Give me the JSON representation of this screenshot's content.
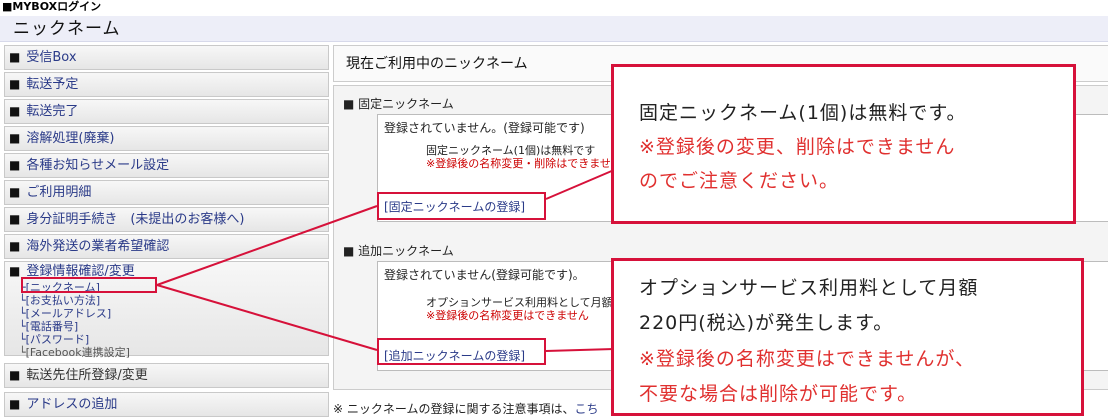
{
  "header": {
    "top_label": "■MYBOXログイン",
    "page_title": "ニックネーム"
  },
  "sidebar": {
    "items": [
      {
        "label": "受信Box"
      },
      {
        "label": "転送予定"
      },
      {
        "label": "転送完了"
      },
      {
        "label": "溶解処理(廃棄)"
      },
      {
        "label": "各種お知らせメール設定"
      },
      {
        "label": "ご利用明細"
      },
      {
        "label": "身分証明手続き　(未提出のお客様へ)"
      },
      {
        "label": "海外発送の業者希望確認"
      },
      {
        "label": "登録情報確認/変更"
      },
      {
        "label": "転送先住所登録/変更"
      },
      {
        "label": "アドレスの追加"
      }
    ],
    "subitems": [
      {
        "label": "ニックネーム"
      },
      {
        "label": "お支払い方法"
      },
      {
        "label": "メールアドレス"
      },
      {
        "label": "電話番号"
      },
      {
        "label": "パスワード"
      },
      {
        "label": "Facebook連携設定"
      }
    ]
  },
  "main": {
    "heading": "現在ご利用中のニックネーム",
    "fixed": {
      "title": "固定ニックネーム",
      "status": "登録されていません。(登録可能です)",
      "desc": "固定ニックネーム(1個)は無料です",
      "warn": "※登録後の名称変更・削除はできません",
      "link": "[固定ニックネームの登録]"
    },
    "extra": {
      "title": "追加ニックネーム",
      "status": "登録されていません(登録可能です)。",
      "desc": "オプションサービス利用料として月額",
      "warn": "※登録後の名称変更はできません",
      "link": "[追加ニックネームの登録]"
    },
    "note_prefix": "※ ニックネームの登録に関する注意事項は、",
    "note_link": "こち"
  },
  "callouts": {
    "first": {
      "line1": "固定ニックネーム(1個)は無料です。",
      "line2": "※登録後の変更、削除はできません",
      "line3": "のでご注意ください。"
    },
    "second": {
      "line1": "オプションサービス利用料として月額",
      "line2": "220円(税込)が発生します。",
      "line3": "※登録後の名称変更はできませんが、",
      "line4": "不要な場合は削除が可能です。"
    }
  },
  "colors": {
    "accent_red": "#d6113a",
    "link_blue": "#2a3a88",
    "title_bg": "#edeef8"
  }
}
